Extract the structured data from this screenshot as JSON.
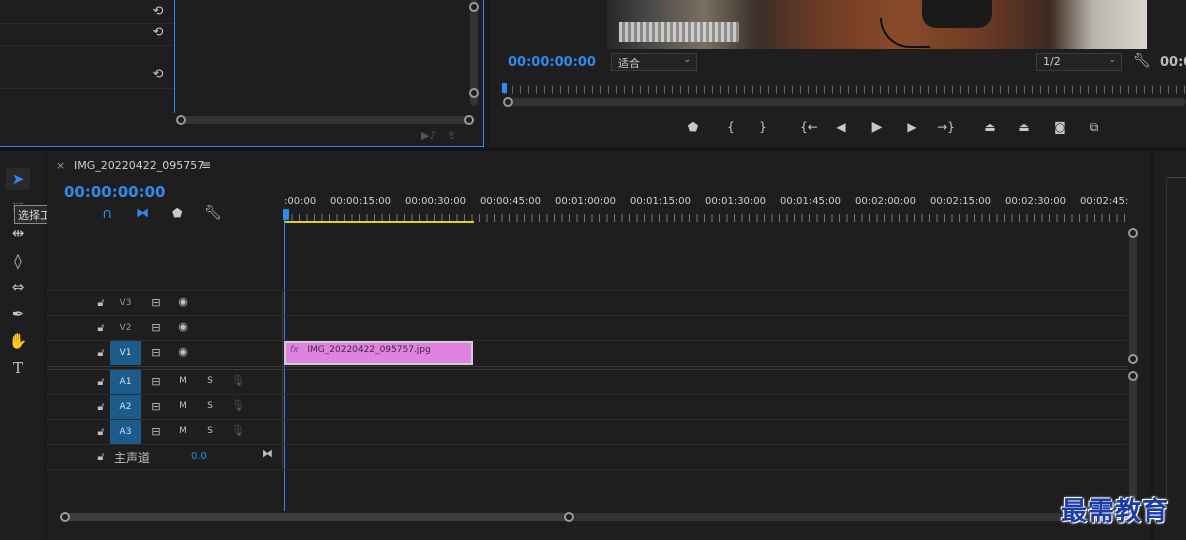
{
  "source_monitor": {
    "reset_icons": [
      "reset-icon",
      "reset-icon",
      "reset-icon"
    ],
    "bottom_icons": [
      "export-frame-icon",
      "insert-icon"
    ]
  },
  "program_monitor": {
    "timecode": "00:00:00:00",
    "fit_dropdown": "适合",
    "resolution_dropdown": "1/2",
    "right_timecode": "00:00"
  },
  "transport": {
    "buttons": [
      {
        "name": "add-marker-button",
        "glyph": "⬟"
      },
      {
        "name": "mark-in-button",
        "glyph": "{"
      },
      {
        "name": "mark-out-button",
        "glyph": "}"
      },
      {
        "name": "go-to-in-button",
        "glyph": "{←"
      },
      {
        "name": "step-back-button",
        "glyph": "◀▏"
      },
      {
        "name": "play-button",
        "glyph": "▶"
      },
      {
        "name": "step-forward-button",
        "glyph": "▕▶"
      },
      {
        "name": "go-to-out-button",
        "glyph": "→}"
      },
      {
        "name": "lift-button",
        "glyph": "⎍"
      },
      {
        "name": "extract-button",
        "glyph": "⎍"
      },
      {
        "name": "export-frame-button",
        "glyph": "📷"
      },
      {
        "name": "compare-button",
        "glyph": "⧉"
      }
    ]
  },
  "tools": {
    "tooltip": "选择工具 (V)"
  },
  "timeline": {
    "tab_close": "×",
    "tab_title": "IMG_20220422_095757",
    "tab_menu": "≡",
    "timecode": "00:00:00:00",
    "ruler": [
      ":00:00",
      "00:00:15:00",
      "00:00:30:00",
      "00:00:45:00",
      "00:01:00:00",
      "00:01:15:00",
      "00:01:30:00",
      "00:01:45:00",
      "00:02:00:00",
      "00:02:15:00",
      "00:02:30:00",
      "00:02:45:"
    ],
    "video_tracks": [
      "V3",
      "V2",
      "V1"
    ],
    "audio_tracks": [
      "A1",
      "A2",
      "A3"
    ],
    "mute_label": "M",
    "solo_label": "S",
    "master_label": "主声道",
    "master_value": "0.0",
    "clip": {
      "fx": "fx",
      "name": "IMG_20220422_095757.jpg"
    }
  },
  "watermark": "最需教育",
  "colors": {
    "accent": "#2d8ceb",
    "clip": "#e181e2",
    "track_active": "#1d5b8b",
    "work_area": "#e3d01b"
  }
}
